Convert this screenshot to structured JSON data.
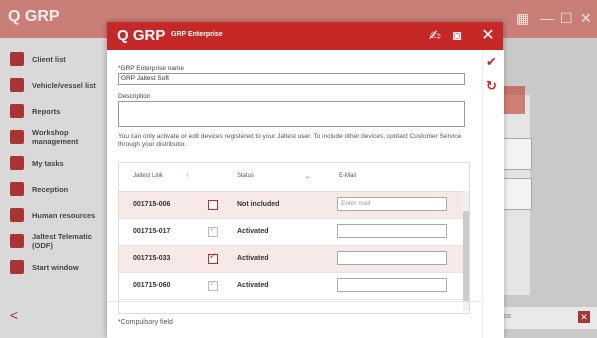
{
  "app": {
    "logo": "Q GRP"
  },
  "sidebar": {
    "items": [
      {
        "label": "Client list",
        "icon": "client-list-icon"
      },
      {
        "label": "Vehicle/vessel list",
        "icon": "vehicle-icon"
      },
      {
        "label": "Reports",
        "icon": "reports-icon"
      },
      {
        "label": "Workshop management",
        "icon": "workshop-icon"
      },
      {
        "label": "My tasks",
        "icon": "tasks-icon"
      },
      {
        "label": "Reception",
        "icon": "reception-icon"
      },
      {
        "label": "Human resources",
        "icon": "human-resources-icon"
      },
      {
        "label": "Jaltest Telematic (ODF)",
        "icon": "telematic-icon"
      },
      {
        "label": "Start window",
        "icon": "home-icon"
      }
    ],
    "back_glyph": "<"
  },
  "background": {
    "bottom_text": "tor."
  },
  "dialog": {
    "logo": "Q GRP",
    "title": "GRP Enterprise",
    "enterprise_label": "*GRP Enterprise name",
    "enterprise_value": "GRP Jaltest Soft",
    "description_label": "Description",
    "description_value": "",
    "info": "You can only activate or edit devices registered to your Jaltest user. To include other devices, contact Customer Service through your distributor.",
    "columns": {
      "link": "Jaltest Link",
      "sort_glyph": "↑",
      "status": "Status",
      "email": "E-Mail"
    },
    "rows": [
      {
        "code": "001715-006",
        "status": "Not included",
        "checked": false,
        "email": "",
        "email_placeholder": "Enter mail",
        "highlight": true
      },
      {
        "code": "001715-017",
        "status": "Activated",
        "checked": true,
        "email": "",
        "email_placeholder": "",
        "highlight": false
      },
      {
        "code": "001715-033",
        "status": "Activated",
        "checked": true,
        "email": "",
        "email_placeholder": "",
        "highlight": true
      },
      {
        "code": "001715-060",
        "status": "Activated",
        "checked": true,
        "email": "",
        "email_placeholder": "",
        "highlight": false
      }
    ],
    "footer": "*Compulsory field"
  },
  "colors": {
    "brand": "#c62828",
    "row_highlight": "#f8e9e9"
  }
}
